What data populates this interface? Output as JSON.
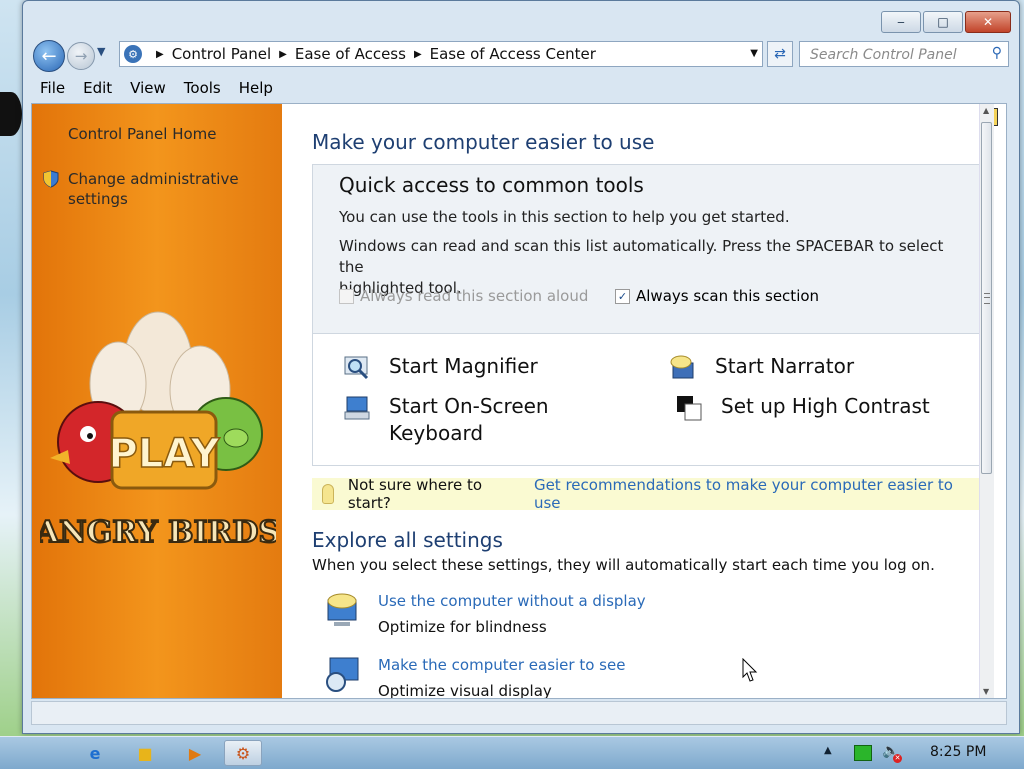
{
  "window": {
    "controls": {
      "minimize": "‒",
      "maximize": "□",
      "close": "✕"
    }
  },
  "nav": {
    "back_icon": "arrow-left-icon",
    "forward_icon": "arrow-right-icon",
    "breadcrumb": [
      "Control Panel",
      "Ease of Access",
      "Ease of Access Center"
    ],
    "search_placeholder": "Search Control Panel"
  },
  "menu": [
    "File",
    "Edit",
    "View",
    "Tools",
    "Help"
  ],
  "sidebar": {
    "home_link": "Control Panel Home",
    "admin_link_line1": "Change administrative",
    "admin_link_line2": "settings",
    "art_play": "PLAY",
    "art_title": "ANGRY BIRDS"
  },
  "main": {
    "title": "Make your computer easier to use",
    "quick": {
      "title": "Quick access to common tools",
      "line1": "You can use the tools in this section to help you get started.",
      "line2a": "Windows can read and scan this list automatically.  Press the SPACEBAR to select the",
      "line2b": "highlighted tool.",
      "read_aloud": {
        "label": "Always read this section aloud",
        "checked": false,
        "enabled": false
      },
      "scan": {
        "label": "Always scan this section",
        "checked": true,
        "enabled": true
      },
      "tools": {
        "magnifier": "Start Magnifier",
        "narrator": "Start Narrator",
        "osk_line1": "Start On-Screen",
        "osk_line2": "Keyboard",
        "contrast": "Set up High Contrast"
      }
    },
    "recommend": {
      "prefix": "Not sure where to start?",
      "link": "Get recommendations to make your computer easier to use"
    },
    "explore": {
      "title": "Explore all settings",
      "desc": "When you select these settings, they will automatically start each time you log on.",
      "items": [
        {
          "link": "Use the computer without a display",
          "sub": "Optimize for blindness"
        },
        {
          "link": "Make the computer easier to see",
          "sub": "Optimize visual display"
        }
      ]
    }
  },
  "taskbar": {
    "clock": "8:25 PM"
  },
  "colors": {
    "sidebar": "#f08a14",
    "link": "#2a6ab8",
    "heading": "#1e3f72"
  }
}
